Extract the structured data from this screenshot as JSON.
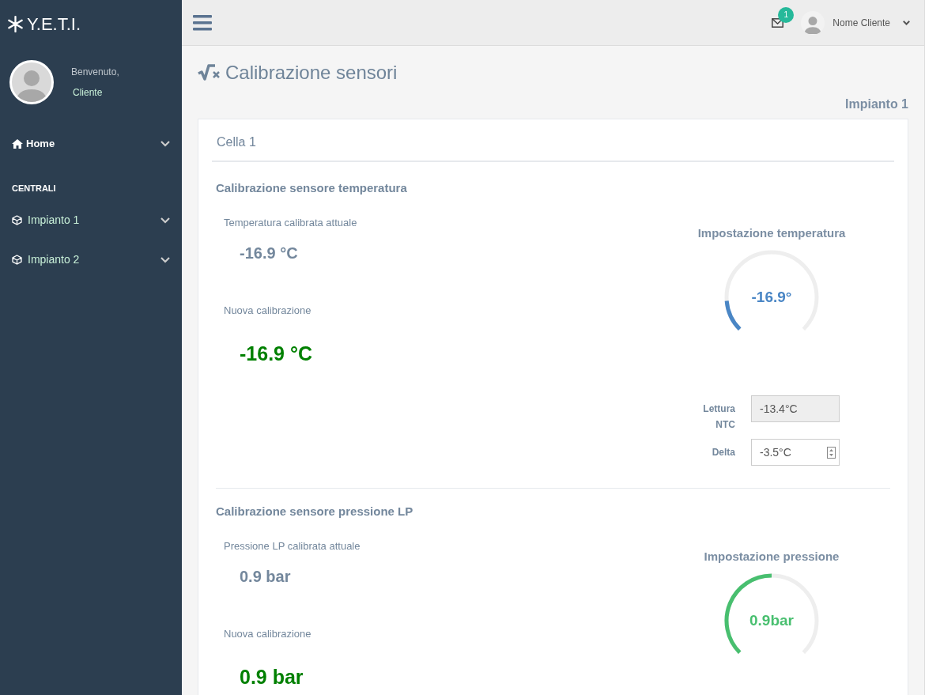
{
  "brand": "Y.E.T.I.",
  "user": {
    "greeting": "Benvenuto,",
    "name": "Cliente"
  },
  "menu": [
    {
      "kind": "home",
      "label": "Home",
      "expanded": false
    }
  ],
  "section_heading": "CENTRALI",
  "plants": [
    {
      "label": "Impianto 1",
      "expanded": false
    },
    {
      "label": "Impianto 2",
      "expanded": false
    }
  ],
  "header": {
    "badge": "1",
    "user_name": "Nome Cliente"
  },
  "page_title": "Calibrazione sensori",
  "plant_name": "Impianto 1",
  "card_title": "Cella 1",
  "sections": [
    {
      "title": "Calibrazione sensore temperatura",
      "current_label": "Temperatura calibrata attuale",
      "current_value": "-16.9 °C",
      "new_label": "Nuova calibrazione",
      "new_value": "-16.9 °C",
      "gauge": {
        "title": "Impostazione temperatura",
        "value": "-16.9°",
        "level": 0.15,
        "color": "#4a86c5"
      },
      "fields": [
        {
          "label": "Lettura NTC",
          "value": "-13.4°C",
          "kind": "readonly"
        },
        {
          "label": "Delta",
          "value": "-3.5°C",
          "kind": "spinner"
        }
      ]
    },
    {
      "title": "Calibrazione sensore pressione LP",
      "current_label": "Pressione LP calibrata attuale",
      "current_value": "0.9 bar",
      "new_label": "Nuova calibrazione",
      "new_value": "0.9 bar",
      "gauge": {
        "title": "Impostazione pressione",
        "value": "0.9bar",
        "level": 0.5,
        "color": "#48bf6f"
      }
    }
  ]
}
